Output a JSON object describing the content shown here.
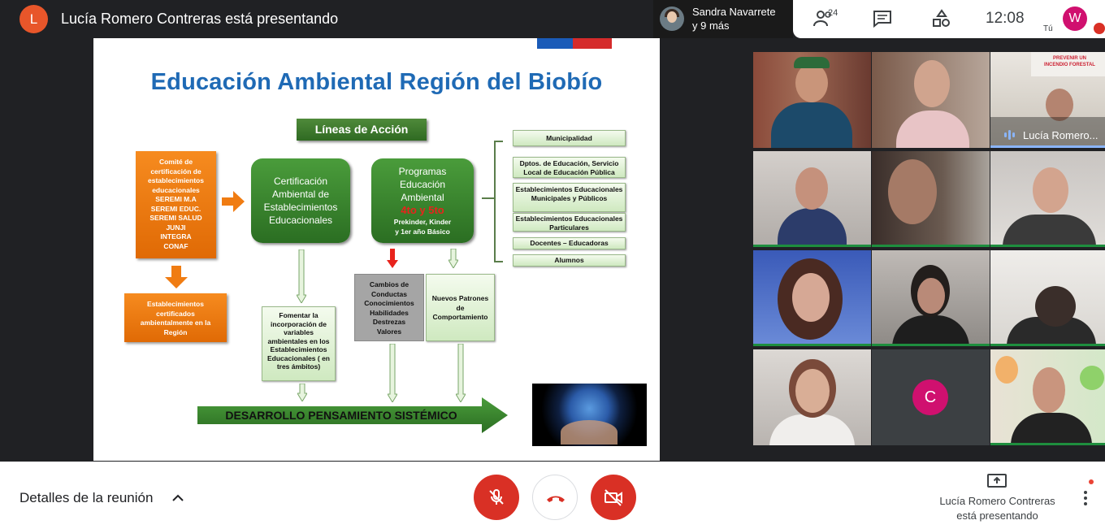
{
  "topbar": {
    "presenter_initial": "L",
    "presenter_title": "Lucía Romero Contreras está presentando",
    "pinned_name_line1": "Sandra Navarrete",
    "pinned_name_line2": "y 9 más",
    "participant_count": "24",
    "time": "12:08",
    "me_initial": "W",
    "me_label": "Tú"
  },
  "slide": {
    "title": "Educación Ambiental Región del Biobío",
    "lineas": "Líneas de Acción",
    "committee": [
      "Comité de",
      "certificación de",
      "establecimientos",
      "educacionales",
      "SEREMI M.A",
      "SEREMI EDUC.",
      "SEREMI SALUD",
      "JUNJI",
      "INTEGRA",
      "CONAF"
    ],
    "certified": [
      "Establecimientos",
      "certificados",
      "ambientalmente en la",
      "Región"
    ],
    "certificacion": [
      "Certificación",
      "Ambiental de",
      "Establecimientos",
      "Educacionales"
    ],
    "programas_title": [
      "Programas",
      "Educación",
      "Ambiental"
    ],
    "programas_red": "4to y 5to",
    "programas_sub": [
      "Prekinder, Kinder",
      "y 1er año Básico"
    ],
    "list": [
      "Municipalidad",
      "Dptos. de Educación, Servicio Local de Educación Pública",
      "Establecimientos Educacionales Municipales y Públicos",
      "Establecimientos Educacionales Particulares",
      "Docentes – Educadoras",
      "Alumnos"
    ],
    "fomentar": [
      "Fomentar la",
      "incorporación de",
      "variables",
      "ambientales en los",
      "Establecimientos",
      "Educacionales ( en",
      "tres ámbitos)"
    ],
    "cambios": [
      "Cambios de",
      "Conductas",
      "Conocimientos",
      "Habilidades",
      "Destrezas",
      "Valores"
    ],
    "nuevos": [
      "Nuevos Patrones",
      "de",
      "Comportamiento"
    ],
    "desarrollo": "DESARROLLO PENSAMIENTO SISTÉMICO"
  },
  "gallery": {
    "presenter_tile_name": "Lucía Romero...",
    "c_initial": "C",
    "poster_text": [
      "PREVENIR UN",
      "INCENDIO FORESTAL"
    ]
  },
  "bottombar": {
    "details": "Detalles de la reunión",
    "presenting_line1": "Lucía Romero Contreras",
    "presenting_line2": "está presentando"
  },
  "colors": {
    "accent_red": "#d93025",
    "grid_green": "#1e8e3e",
    "title_blue": "#1f6ab5"
  }
}
